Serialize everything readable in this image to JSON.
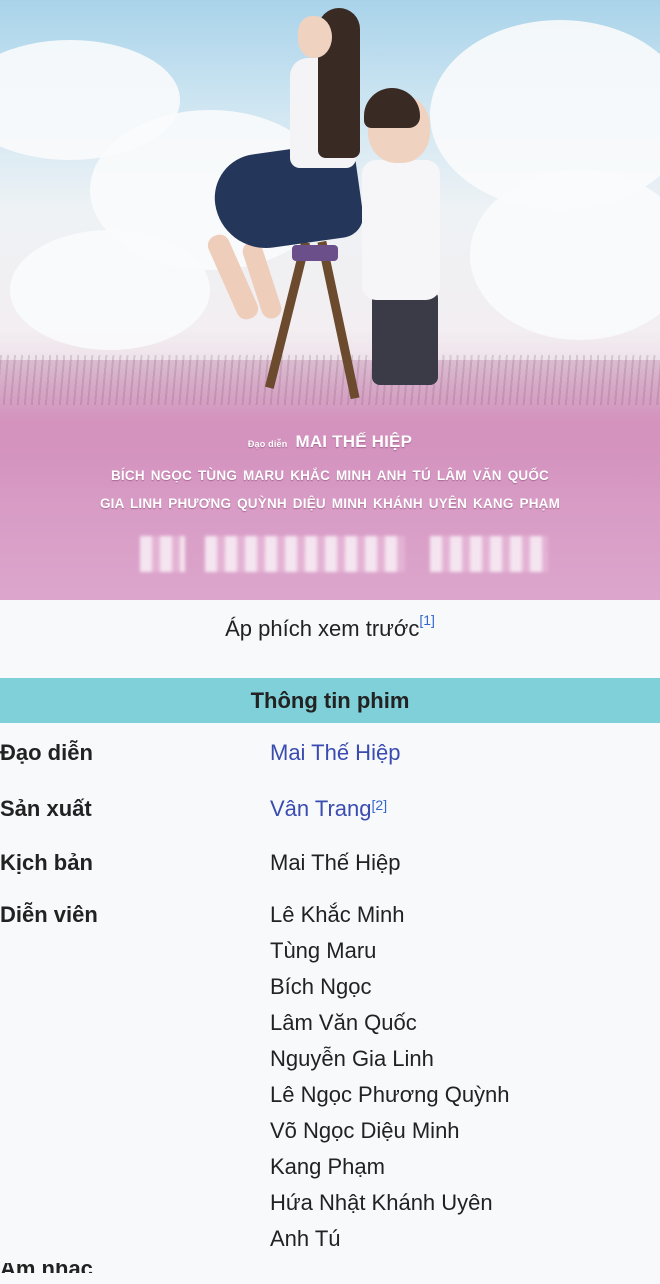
{
  "poster": {
    "director_prefix": "Đạo diễn",
    "director_name": "MAI THẾ HIỆP",
    "cast_line1": "BÍCH NGỌC  TÙNG MARU  KHẮC MINH  ANH TÚ  LÂM VĂN QUỐC",
    "cast_line2": "GIA LINH  PHƯƠNG QUỲNH  DIỆU MINH  KHÁNH UYÊN  KANG PHẠM"
  },
  "caption": {
    "text": "Áp phích xem trước",
    "ref": "[1]"
  },
  "infobox": {
    "header": "Thông tin phim",
    "director": {
      "label": "Đạo diễn",
      "value": "Mai Thế Hiệp"
    },
    "producer": {
      "label": "Sản xuất",
      "value": "Vân Trang",
      "ref": "[2]"
    },
    "writer": {
      "label": "Kịch bản",
      "value": "Mai Thế Hiệp"
    },
    "cast": {
      "label": "Diễn viên",
      "items": [
        "Lê Khắc Minh",
        "Tùng Maru",
        "Bích Ngọc",
        "Lâm Văn Quốc",
        "Nguyễn Gia Linh",
        "Lê Ngọc Phương Quỳnh",
        "Võ Ngọc Diệu Minh",
        "Kang Phạm",
        "Hứa Nhật Khánh Uyên",
        "Anh Tú"
      ]
    },
    "next_label_cutoff": "Âm nhạc"
  }
}
